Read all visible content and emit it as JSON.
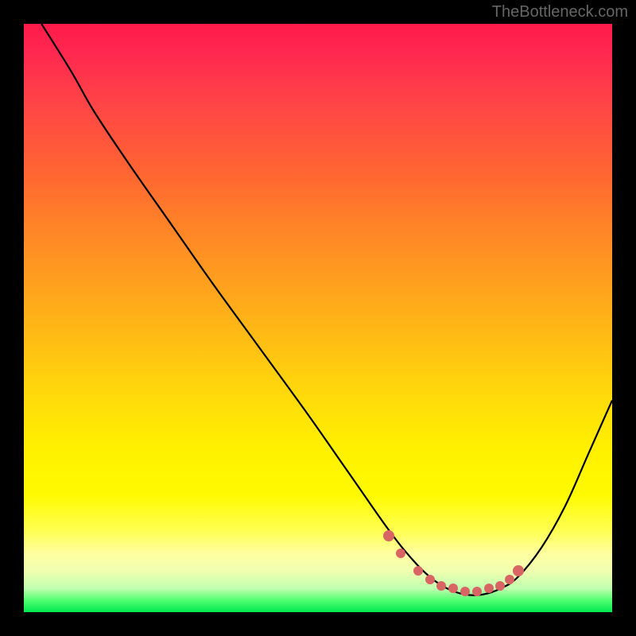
{
  "watermark": "TheBottleneck.com",
  "chart_data": {
    "type": "line",
    "title": "",
    "xlabel": "",
    "ylabel": "",
    "xlim": [
      0,
      100
    ],
    "ylim": [
      0,
      100
    ],
    "grid": false,
    "series": [
      {
        "name": "bottleneck-curve",
        "x": [
          3,
          8,
          12,
          18,
          25,
          32,
          40,
          48,
          55,
          62,
          66,
          69,
          72,
          75,
          78,
          81,
          84,
          88,
          92,
          96,
          100
        ],
        "values": [
          100,
          92,
          85,
          76,
          66,
          56,
          45,
          34,
          24,
          14,
          9,
          6,
          4,
          3,
          3,
          4,
          6,
          11,
          18,
          27,
          36
        ]
      }
    ],
    "markers": {
      "name": "highlight-range",
      "points": [
        {
          "x": 62,
          "y": 13
        },
        {
          "x": 64,
          "y": 10
        },
        {
          "x": 67,
          "y": 7
        },
        {
          "x": 69,
          "y": 5.5
        },
        {
          "x": 71,
          "y": 4.5
        },
        {
          "x": 73,
          "y": 4
        },
        {
          "x": 75,
          "y": 3.5
        },
        {
          "x": 77,
          "y": 3.5
        },
        {
          "x": 79,
          "y": 4
        },
        {
          "x": 81,
          "y": 4.5
        },
        {
          "x": 82.5,
          "y": 5.5
        },
        {
          "x": 84,
          "y": 7
        }
      ]
    },
    "background_gradient": {
      "top": "#ff1a4a",
      "mid": "#ffdc0a",
      "bottom": "#00e850"
    }
  }
}
